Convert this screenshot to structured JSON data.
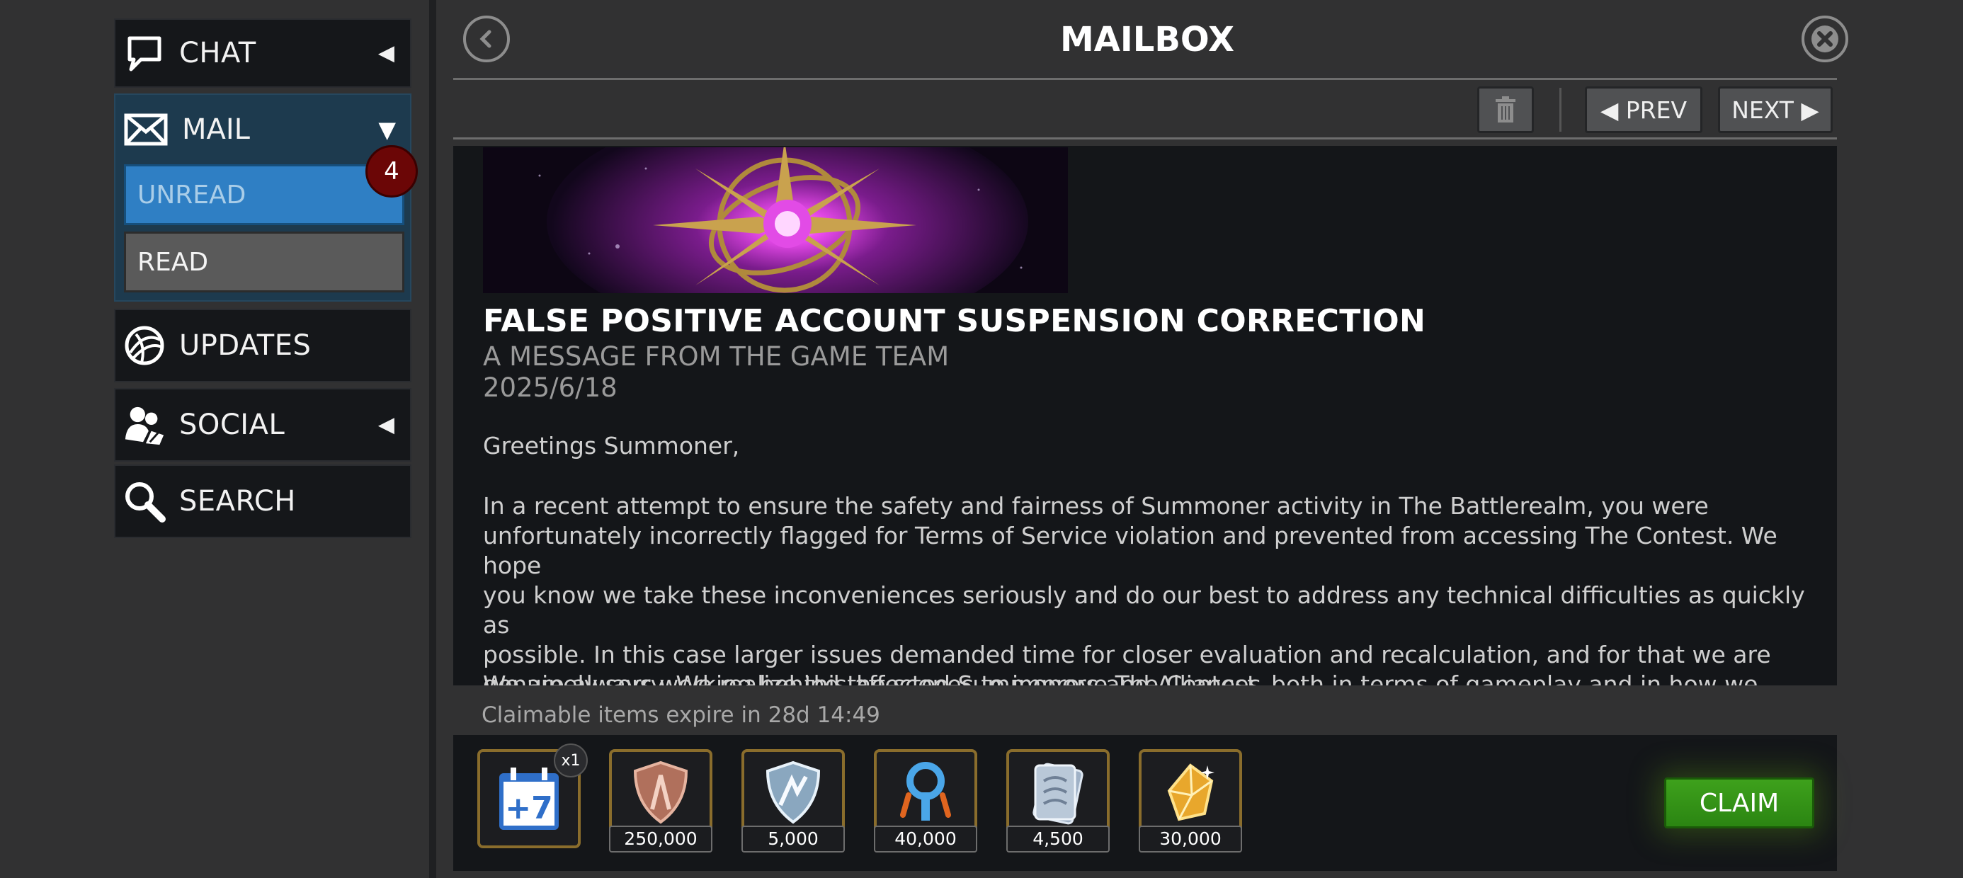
{
  "sidebar": {
    "chat_label": "CHAT",
    "mail_label": "MAIL",
    "unread_label": "UNREAD",
    "unread_count": "4",
    "read_label": "READ",
    "updates_label": "UPDATES",
    "social_label": "SOCIAL",
    "search_label": "SEARCH"
  },
  "header": {
    "title": "MAILBOX"
  },
  "toolbar": {
    "prev_label": "◀ PREV",
    "next_label": "NEXT ▶"
  },
  "message": {
    "title": "FALSE POSITIVE ACCOUNT SUSPENSION CORRECTION",
    "subtitle": "A MESSAGE FROM THE GAME TEAM",
    "date": "2025/6/18",
    "greeting": "Greetings Summoner,",
    "body_lines": [
      "In a recent attempt to ensure the safety and fairness of Summoner activity in The Battlerealm, you were",
      "unfortunately incorrectly flagged for Terms of Service violation and prevented from accessing The Contest. We hope",
      "you know we take these inconveniences seriously and do our best to address any technical difficulties as quickly as",
      "possible. In this case larger issues demanded time for closer evaluation and recalculation, and for that we are",
      "genuinely sorry. We realize this affected Summoners and Alliances"
    ],
    "cut_line": "We are always working behind the scenes to improve The Contest, both in terms of gameplay and in how we"
  },
  "claim": {
    "expire_text": "Claimable items expire in 28d 14:49",
    "button_label": "CLAIM",
    "rewards": [
      {
        "icon": "plus-7-calendar-icon",
        "badge": "x1"
      },
      {
        "icon": "bronze-shield-icon",
        "quantity": "250,000"
      },
      {
        "icon": "silver-shield-icon",
        "quantity": "5,000"
      },
      {
        "icon": "blue-key-icon",
        "quantity": "40,000"
      },
      {
        "icon": "silver-card-icon",
        "quantity": "4,500"
      },
      {
        "icon": "gold-crystal-icon",
        "quantity": "30,000"
      }
    ]
  }
}
